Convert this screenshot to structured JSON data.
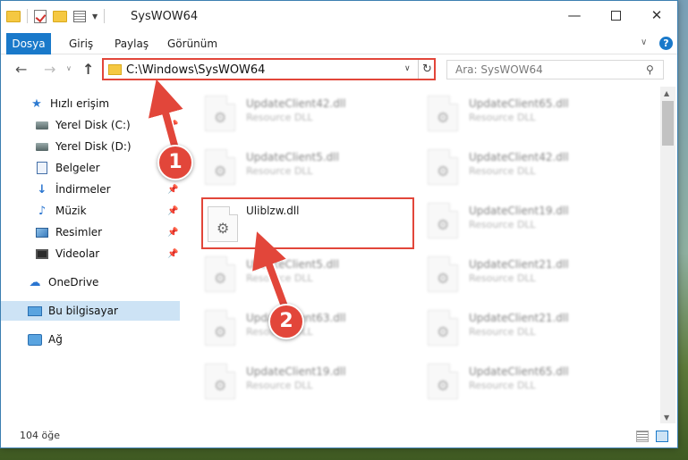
{
  "window": {
    "title": "SysWOW64",
    "minimize": "—",
    "maximize": "",
    "close": "✕"
  },
  "ribbon": {
    "file": "Dosya",
    "tabs": [
      "Giriş",
      "Paylaş",
      "Görünüm"
    ],
    "help": "?"
  },
  "address": {
    "path": "C:\\Windows\\SysWOW64",
    "search_placeholder": "Ara: SysWOW64"
  },
  "sidebar": {
    "items": [
      {
        "label": "Hızlı erişim",
        "icon": "star-icon"
      },
      {
        "label": "Yerel Disk (C:)",
        "icon": "disk-icon",
        "pinned": true
      },
      {
        "label": "Yerel Disk (D:)",
        "icon": "disk-icon",
        "pinned": true
      },
      {
        "label": "Belgeler",
        "icon": "document-icon",
        "pinned": true
      },
      {
        "label": "İndirmeler",
        "icon": "download-icon",
        "pinned": true
      },
      {
        "label": "Müzik",
        "icon": "music-icon",
        "pinned": true
      },
      {
        "label": "Resimler",
        "icon": "picture-icon",
        "pinned": true
      },
      {
        "label": "Videolar",
        "icon": "video-icon",
        "pinned": true
      },
      {
        "label": "OneDrive",
        "icon": "cloud-icon"
      },
      {
        "label": "Bu bilgisayar",
        "icon": "computer-icon",
        "selected": true
      },
      {
        "label": "Ağ",
        "icon": "network-icon"
      }
    ]
  },
  "files": [
    {
      "name": "UpdateClient42.dll",
      "type": "Resource DLL",
      "blurred": true
    },
    {
      "name": "UpdateClient65.dll",
      "type": "Resource DLL",
      "blurred": true
    },
    {
      "name": "UpdateClient5.dll",
      "type": "Resource DLL",
      "blurred": true
    },
    {
      "name": "UpdateClient42.dll",
      "type": "Resource DLL",
      "blurred": true
    },
    {
      "name": "Uliblzw.dll",
      "type": "",
      "highlighted": true
    },
    {
      "name": "UpdateClient19.dll",
      "type": "Resource DLL",
      "blurred": true
    },
    {
      "name": "UpdateClient5.dll",
      "type": "Resource DLL",
      "blurred": true
    },
    {
      "name": "UpdateClient21.dll",
      "type": "Resource DLL",
      "blurred": true
    },
    {
      "name": "UpdateClient63.dll",
      "type": "Resource DLL",
      "blurred": true
    },
    {
      "name": "UpdateClient21.dll",
      "type": "Resource DLL",
      "blurred": true
    },
    {
      "name": "UpdateClient19.dll",
      "type": "Resource DLL",
      "blurred": true
    },
    {
      "name": "UpdateClient65.dll",
      "type": "Resource DLL",
      "blurred": true
    }
  ],
  "status": {
    "count": "104 öğe"
  },
  "annotations": {
    "step1": "1",
    "step2": "2",
    "color": "#e2463a"
  }
}
